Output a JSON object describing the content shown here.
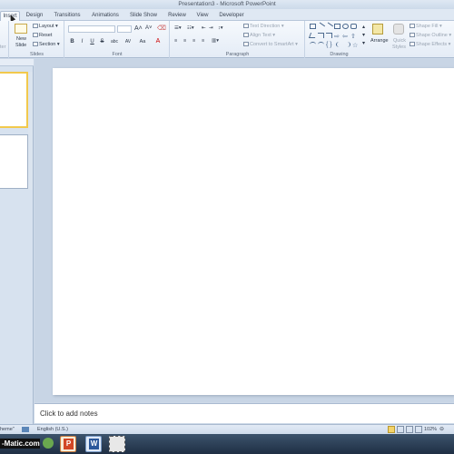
{
  "window": {
    "title": "Presentation3 - Microsoft PowerPoint"
  },
  "tabs": [
    "Insert",
    "Design",
    "Transitions",
    "Animations",
    "Slide Show",
    "Review",
    "View",
    "Developer"
  ],
  "ribbon": {
    "slides": {
      "new_slide": "New",
      "new_slide2": "Slide",
      "layout": "Layout",
      "reset": "Reset",
      "section": "Section",
      "label": "Slides"
    },
    "font": {
      "bold": "B",
      "italic": "I",
      "underline": "U",
      "strike": "S",
      "shadow": "abc",
      "spacing": "AV",
      "case": "Aa",
      "label": "Font"
    },
    "paragraph": {
      "text_direction": "Text Direction",
      "align_text": "Align Text",
      "convert": "Convert to SmartArt",
      "label": "Paragraph"
    },
    "drawing": {
      "arrange": "Arrange",
      "quick_styles": "Quick",
      "quick_styles2": "Styles",
      "shape_fill": "Shape Fill",
      "shape_outline": "Shape Outline",
      "shape_effects": "Shape Effects",
      "label": "Drawing"
    },
    "cut_label": "ter"
  },
  "notes": {
    "placeholder": "Click to add notes"
  },
  "statusbar": {
    "theme": "heme\"",
    "language": "English (U.S.)",
    "zoom": "102%"
  },
  "taskbar": {
    "watermark": "-Matic.com"
  }
}
